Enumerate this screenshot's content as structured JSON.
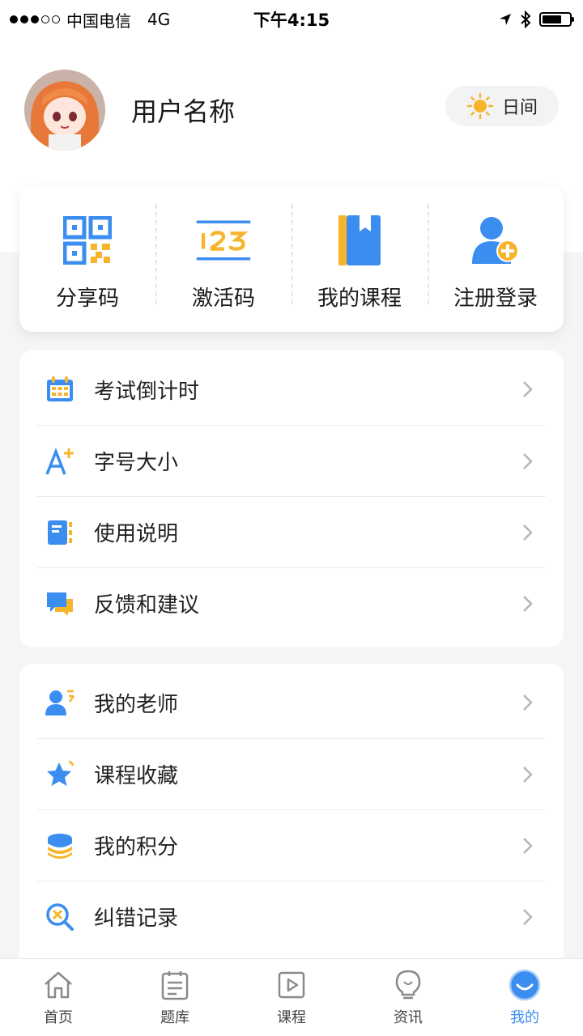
{
  "status_bar": {
    "carrier": "中国电信",
    "network": "4G",
    "time": "下午4:15"
  },
  "profile": {
    "username": "用户名称",
    "theme_label": "日间"
  },
  "quick_actions": [
    {
      "label": "分享码",
      "icon": "qr-code-icon"
    },
    {
      "label": "激活码",
      "icon": "activation-code-icon"
    },
    {
      "label": "我的课程",
      "icon": "book-icon"
    },
    {
      "label": "注册登录",
      "icon": "add-user-icon"
    }
  ],
  "menu_group_1": [
    {
      "label": "考试倒计时",
      "icon": "calendar-icon"
    },
    {
      "label": "字号大小",
      "icon": "font-size-icon"
    },
    {
      "label": "使用说明",
      "icon": "manual-icon"
    },
    {
      "label": "反馈和建议",
      "icon": "feedback-icon"
    }
  ],
  "menu_group_2": [
    {
      "label": "我的老师",
      "icon": "teacher-icon"
    },
    {
      "label": "课程收藏",
      "icon": "star-icon"
    },
    {
      "label": "我的积分",
      "icon": "coins-icon"
    },
    {
      "label": "纠错记录",
      "icon": "error-search-icon"
    }
  ],
  "tabbar": [
    {
      "label": "首页",
      "icon": "home-icon"
    },
    {
      "label": "题库",
      "icon": "question-bank-icon"
    },
    {
      "label": "课程",
      "icon": "video-icon"
    },
    {
      "label": "资讯",
      "icon": "lightbulb-icon"
    },
    {
      "label": "我的",
      "icon": "profile-icon",
      "active": true
    }
  ],
  "colors": {
    "accent_blue": "#3b8ef0",
    "accent_yellow": "#f7b52c",
    "background": "#f4f5f7"
  }
}
